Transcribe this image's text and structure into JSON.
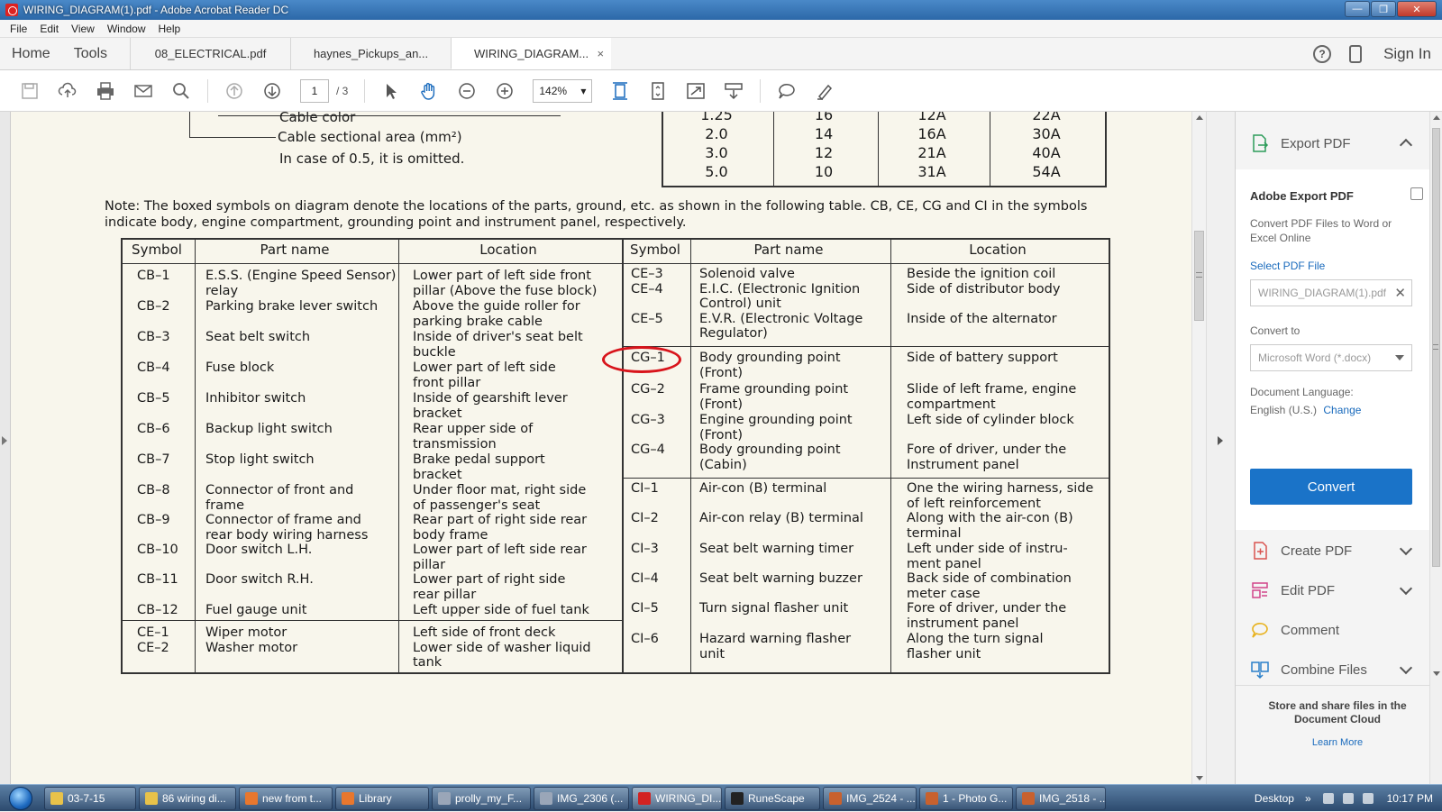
{
  "window": {
    "title": "WIRING_DIAGRAM(1).pdf - Adobe Acrobat Reader DC",
    "minimize": "—",
    "maximize": "❐",
    "close": "✕"
  },
  "menu": [
    "File",
    "Edit",
    "View",
    "Window",
    "Help"
  ],
  "tabs": {
    "home": "Home",
    "tools": "Tools",
    "documents": [
      {
        "label": "08_ELECTRICAL.pdf",
        "active": false
      },
      {
        "label": "haynes_Pickups_an...",
        "active": false
      },
      {
        "label": "WIRING_DIAGRAM...",
        "active": true
      }
    ],
    "close_glyph": "×",
    "help_glyph": "?",
    "sign_in": "Sign In"
  },
  "toolbar": {
    "page_current": "1",
    "page_total": "/ 3",
    "zoom": "142%",
    "zoom_caret": "▾"
  },
  "document": {
    "cable_lines": [
      "Cable color",
      "Cable sectional area (mm²)",
      "In case of 0.5, it is omitted."
    ],
    "amp_rows": [
      [
        "1.25",
        "16",
        "12A",
        "22A"
      ],
      [
        "2.0",
        "14",
        "16A",
        "30A"
      ],
      [
        "3.0",
        "12",
        "21A",
        "40A"
      ],
      [
        "5.0",
        "10",
        "31A",
        "54A"
      ]
    ],
    "note": "Note: The boxed symbols on diagram denote the locations of the parts, ground, etc. as shown in the following table.  CB, CE, CG and CI in the symbols indicate body, engine compartment, grounding point and instrument panel, respectively.",
    "headers": [
      "Symbol",
      "Part name",
      "Location",
      "Symbol",
      "Part name",
      "Location"
    ],
    "left_rows": [
      {
        "symbol": "CB–1",
        "part": "E.S.S. (Engine Speed Sensor)\nrelay",
        "location": "Lower part of left side front\npillar (Above the fuse block)"
      },
      {
        "symbol": "CB–2",
        "part": "Parking brake lever switch",
        "location": "Above the guide roller for\nparking brake cable"
      },
      {
        "symbol": "CB–3",
        "part": "Seat belt switch",
        "location": "Inside of driver's seat belt\nbuckle"
      },
      {
        "symbol": "CB–4",
        "part": "Fuse block",
        "location": "Lower part of left side\nfront pillar"
      },
      {
        "symbol": "CB–5",
        "part": "Inhibitor switch",
        "location": "Inside of gearshift lever\nbracket"
      },
      {
        "symbol": "CB–6",
        "part": "Backup light switch",
        "location": "Rear upper side of\ntransmission"
      },
      {
        "symbol": "CB–7",
        "part": "Stop light switch",
        "location": "Brake pedal support\nbracket"
      },
      {
        "symbol": "CB–8",
        "part": "Connector of front and\nframe",
        "location": "Under floor mat, right side\nof passenger's seat"
      },
      {
        "symbol": "CB–9",
        "part": "Connector of frame and\nrear body wiring harness",
        "location": "Rear part of right side rear\nbody frame"
      },
      {
        "symbol": "CB–10",
        "part": "Door switch L.H.",
        "location": "Lower part of left side rear\npillar"
      },
      {
        "symbol": "CB–11",
        "part": "Door switch R.H.",
        "location": "Lower part of right side\nrear pillar"
      },
      {
        "symbol": "CB–12",
        "part": "Fuel gauge unit",
        "location": "Left upper side of fuel tank"
      },
      {
        "symbol": "CE–1\nCE–2",
        "part": "Wiper motor\nWasher motor",
        "location": "Left side of front deck\nLower side of washer liquid\ntank"
      }
    ],
    "right_rows": [
      {
        "symbol": "CE–3\nCE–4\n\nCE–5",
        "part": "Solenoid valve\nE.I.C. (Electronic Ignition\nControl) unit\nE.V.R. (Electronic Voltage\nRegulator)",
        "location": "Beside the ignition coil\nSide of distributor body\n\nInside of the alternator"
      },
      {
        "symbol": "CG–1",
        "part": "Body grounding point\n(Front)",
        "location": "Side of battery support"
      },
      {
        "symbol": "CG–2",
        "part": "Frame grounding point\n(Front)",
        "location": "Slide of left frame, engine\ncompartment"
      },
      {
        "symbol": "CG–3",
        "part": "Engine grounding point\n(Front)",
        "location": "Left side of cylinder block"
      },
      {
        "symbol": "CG–4",
        "part": "Body grounding point\n(Cabin)",
        "location": "Fore of driver, under the\nInstrument panel"
      },
      {
        "symbol": "CI–1",
        "part": "Air-con (B) terminal",
        "location": "One the wiring harness, side\nof left reinforcement"
      },
      {
        "symbol": "CI–2",
        "part": "Air-con relay (B) terminal",
        "location": "Along with the air-con (B)\nterminal"
      },
      {
        "symbol": "CI–3",
        "part": "Seat belt warning timer",
        "location": "Left under side of instru-\nment panel"
      },
      {
        "symbol": "CI–4",
        "part": "Seat belt warning buzzer",
        "location": "Back side of combination\nmeter case"
      },
      {
        "symbol": "CI–5",
        "part": "Turn signal flasher unit",
        "location": "Fore of driver, under the\ninstrument panel"
      },
      {
        "symbol": "CI–6",
        "part": "Hazard warning flasher\nunit",
        "location": "Along the turn signal\nflasher unit"
      }
    ]
  },
  "right_panel": {
    "export_pdf": "Export PDF",
    "card_title": "Adobe Export PDF",
    "card_desc": "Convert PDF Files to Word or Excel Online",
    "select_file": "Select PDF File",
    "file_value": "WIRING_DIAGRAM(1).pdf",
    "clear_glyph": "✕",
    "convert_to": "Convert to",
    "format": "Microsoft Word (*.docx)",
    "doc_lang_label": "Document Language:",
    "doc_lang": "English (U.S.)",
    "change": "Change",
    "convert_button": "Convert",
    "create_pdf": "Create PDF",
    "edit_pdf": "Edit PDF",
    "comment": "Comment",
    "combine_files": "Combine Files",
    "store_text": "Store and share files in the Document Cloud",
    "learn_more": "Learn More",
    "colors": {
      "accent": "#1a73c8",
      "link": "#1a6bbd",
      "highlight": "#d8141b"
    }
  },
  "taskbar": {
    "items": [
      {
        "label": "03-7-15",
        "color": "#e8c24a",
        "active": false
      },
      {
        "label": "86 wiring di...",
        "color": "#e8c24a",
        "active": false
      },
      {
        "label": "new from t...",
        "color": "#e8772e",
        "active": false
      },
      {
        "label": "Library",
        "color": "#e8772e",
        "active": false
      },
      {
        "label": "prolly_my_F...",
        "color": "#9aa6b8",
        "active": false
      },
      {
        "label": "IMG_2306 (...",
        "color": "#9aa6b8",
        "active": false
      },
      {
        "label": "WIRING_DI...",
        "color": "#d22222",
        "active": true
      },
      {
        "label": "RuneScape",
        "color": "#222222",
        "active": false
      },
      {
        "label": "IMG_2524 - ...",
        "color": "#c8612e",
        "active": false
      },
      {
        "label": "1 - Photo G...",
        "color": "#c8612e",
        "active": false
      },
      {
        "label": "IMG_2518 - ...",
        "color": "#c8612e",
        "active": false
      }
    ],
    "desktop": "Desktop",
    "overflow": "»",
    "clock": "10:17 PM"
  }
}
